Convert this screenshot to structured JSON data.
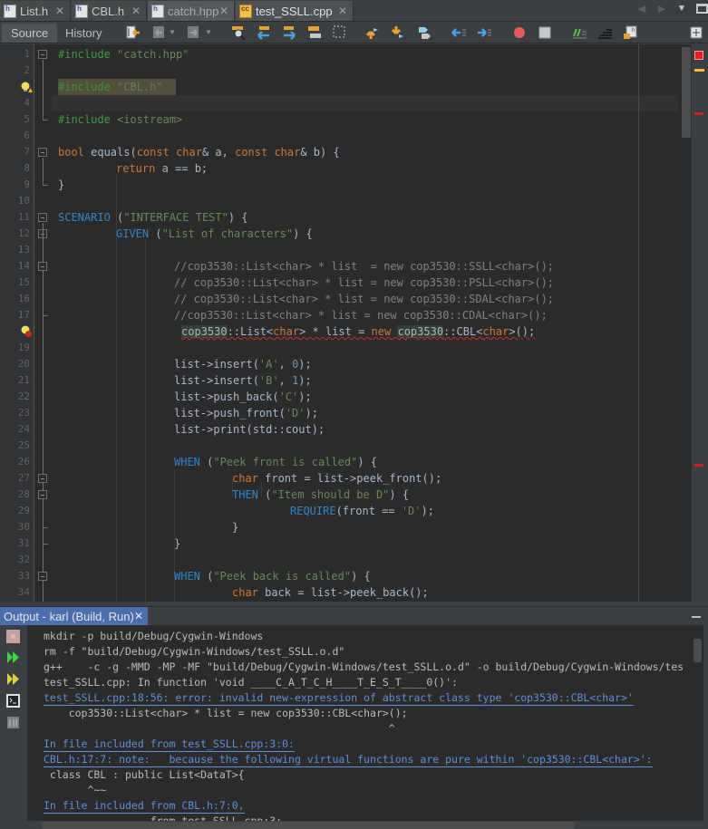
{
  "tabs": [
    {
      "label": "List.h",
      "icon": "header-file-icon",
      "active": false
    },
    {
      "label": "CBL.h",
      "icon": "header-file-icon",
      "active": false
    },
    {
      "label": "catch.hpp",
      "icon": "header-file-icon",
      "active": false
    },
    {
      "label": "test_SSLL.cpp",
      "icon": "cpp-file-icon",
      "active": true
    }
  ],
  "tab_close_glyph": "✕",
  "toolbar": {
    "source_label": "Source",
    "history_label": "History",
    "icons": [
      "last-edit-icon",
      "back-icon",
      "forward-icon",
      "find-selection-icon",
      "find-previous-icon",
      "find-next-icon",
      "toggle-highlight-icon",
      "rectangular-selection-icon",
      "previous-bookmark-icon",
      "next-bookmark-icon",
      "toggle-bookmark-icon",
      "shift-left-icon",
      "shift-right-icon",
      "start-macro-icon",
      "stop-macro-icon",
      "comment-icon",
      "uncomment-icon",
      "header-source-switch-icon",
      "split-icon"
    ]
  },
  "editor": {
    "line_numbers": [
      "1",
      "2",
      "",
      "4",
      "5",
      "6",
      "7",
      "8",
      "9",
      "10",
      "11",
      "12",
      "13",
      "14",
      "15",
      "16",
      "17",
      "",
      "19",
      "20",
      "21",
      "22",
      "23",
      "24",
      "25",
      "26",
      "27",
      "28",
      "29",
      "30",
      "31",
      "32",
      "33",
      "34"
    ],
    "annotations": [
      {
        "line": 3,
        "type": "warning-hint"
      },
      {
        "line": 18,
        "type": "error-hint"
      }
    ],
    "lines": {
      "l1_kw": "#include",
      "l1_str": " \"catch.hpp\"",
      "l3_kw": "#include",
      "l3_str": " \"CBL.h\"",
      "l5_kw": "#include",
      "l5_str": " <iostream>",
      "l7_a": "bool",
      "l7_b": " equals(",
      "l7_c": "const",
      "l7_d": " ",
      "l7_e": "char",
      "l7_f": "& a, ",
      "l7_g": "const",
      "l7_h": " ",
      "l7_i": "char",
      "l7_j": "& b) {",
      "l8_kw": "return",
      "l8_rest": " a == b;",
      "l9": "}",
      "l11_mac": "SCENARIO",
      "l11_rest": " (",
      "l11_str": "\"INTERFACE TEST\"",
      "l11_end": ") {",
      "l12_mac": "GIVEN",
      "l12_rest": " (",
      "l12_str": "\"List of characters\"",
      "l12_end": ") {",
      "l14": "//cop3530::List<char> * list  = new cop3530::SSLL<char>();",
      "l15": "// cop3530::List<char> * list = new cop3530::PSLL<char>();",
      "l16": "// cop3530::List<char> * list = new cop3530::SDAL<char>();",
      "l17": "//cop3530::List<char> * list = new cop3530::CDAL<char>();",
      "l18_a": "cop3530",
      "l18_b": "::List<",
      "l18_c": "char",
      "l18_d": "> * list = ",
      "l18_e": "new",
      "l18_f": " ",
      "l18_g": "cop3530",
      "l18_h": "::CBL<",
      "l18_i": "char",
      "l18_j": ">();",
      "l20_a": "list->insert(",
      "l20_b": "'A'",
      "l20_c": ", ",
      "l20_d": "0",
      "l20_e": ");",
      "l21_a": "list->insert(",
      "l21_b": "'B'",
      "l21_c": ", ",
      "l21_d": "1",
      "l21_e": ");",
      "l22_a": "list->push_back(",
      "l22_b": "'C'",
      "l22_c": ");",
      "l23_a": "list->push_front(",
      "l23_b": "'D'",
      "l23_c": ");",
      "l24": "list->print(std::cout);",
      "l26_mac": "WHEN",
      "l26_rest": " (",
      "l26_str": "\"Peek front is called\"",
      "l26_end": ") {",
      "l27_kw": "char",
      "l27_rest": " front = list->peek_front();",
      "l28_mac": "THEN",
      "l28_rest": " (",
      "l28_str": "\"Item should be D\"",
      "l28_end": ") {",
      "l29_mac": "REQUIRE",
      "l29_rest": "(front == ",
      "l29_str": "'D'",
      "l29_end": ");",
      "l30": "}",
      "l31": "}",
      "l33_mac": "WHEN",
      "l33_rest": " (",
      "l33_str": "\"Peek back is called\"",
      "l33_end": ") {",
      "l34_kw": "char",
      "l34_rest": " back = list->peek_back();"
    }
  },
  "output": {
    "tab_label": "Output - karl (Build, Run)",
    "lines": [
      {
        "text": "mkdir -p build/Debug/Cygwin-Windows",
        "link": false
      },
      {
        "text": "rm -f \"build/Debug/Cygwin-Windows/test_SSLL.o.d\"",
        "link": false
      },
      {
        "text": "g++    -c -g -MMD -MP -MF \"build/Debug/Cygwin-Windows/test_SSLL.o.d\" -o build/Debug/Cygwin-Windows/tes",
        "link": false
      },
      {
        "text": "test_SSLL.cpp: In function 'void ____C_A_T_C_H____T_E_S_T____0()':",
        "link": false
      },
      {
        "text": "test_SSLL.cpp:18:56: error: invalid new-expression of abstract class type 'cop3530::CBL<char>'",
        "link": true
      },
      {
        "text": "    cop3530::List<char> * list = new cop3530::CBL<char>();",
        "link": false
      },
      {
        "text": "                                                       ^",
        "link": false
      },
      {
        "text": "In file included from test_SSLL.cpp:3:0:",
        "link": true
      },
      {
        "text": "CBL.h:17:7: note:   because the following virtual functions are pure within 'cop3530::CBL<char>':",
        "link": true
      },
      {
        "text": " class CBL : public List<DataT>{",
        "link": false
      },
      {
        "text": "       ^~~",
        "link": false
      },
      {
        "text": "In file included from CBL.h:7:0,",
        "link": true
      },
      {
        "text": "                 from test_SSLL.cpp:3:",
        "link": false
      }
    ],
    "side_buttons": [
      "stop-build-icon",
      "rerun-icon",
      "rerun-with-args-icon",
      "terminal-icon",
      "settings-icon"
    ]
  }
}
